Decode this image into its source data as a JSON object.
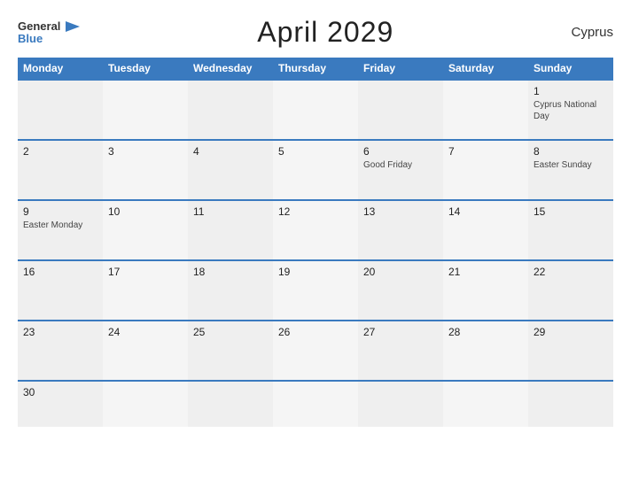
{
  "header": {
    "logo_general": "General",
    "logo_blue": "Blue",
    "title": "April 2029",
    "country": "Cyprus"
  },
  "columns": [
    "Monday",
    "Tuesday",
    "Wednesday",
    "Thursday",
    "Friday",
    "Saturday",
    "Sunday"
  ],
  "rows": [
    [
      {
        "day": "",
        "event": ""
      },
      {
        "day": "",
        "event": ""
      },
      {
        "day": "",
        "event": ""
      },
      {
        "day": "",
        "event": ""
      },
      {
        "day": "",
        "event": ""
      },
      {
        "day": "",
        "event": ""
      },
      {
        "day": "1",
        "event": "Cyprus National Day"
      }
    ],
    [
      {
        "day": "2",
        "event": ""
      },
      {
        "day": "3",
        "event": ""
      },
      {
        "day": "4",
        "event": ""
      },
      {
        "day": "5",
        "event": ""
      },
      {
        "day": "6",
        "event": "Good Friday"
      },
      {
        "day": "7",
        "event": ""
      },
      {
        "day": "8",
        "event": "Easter Sunday"
      }
    ],
    [
      {
        "day": "9",
        "event": "Easter Monday"
      },
      {
        "day": "10",
        "event": ""
      },
      {
        "day": "11",
        "event": ""
      },
      {
        "day": "12",
        "event": ""
      },
      {
        "day": "13",
        "event": ""
      },
      {
        "day": "14",
        "event": ""
      },
      {
        "day": "15",
        "event": ""
      }
    ],
    [
      {
        "day": "16",
        "event": ""
      },
      {
        "day": "17",
        "event": ""
      },
      {
        "day": "18",
        "event": ""
      },
      {
        "day": "19",
        "event": ""
      },
      {
        "day": "20",
        "event": ""
      },
      {
        "day": "21",
        "event": ""
      },
      {
        "day": "22",
        "event": ""
      }
    ],
    [
      {
        "day": "23",
        "event": ""
      },
      {
        "day": "24",
        "event": ""
      },
      {
        "day": "25",
        "event": ""
      },
      {
        "day": "26",
        "event": ""
      },
      {
        "day": "27",
        "event": ""
      },
      {
        "day": "28",
        "event": ""
      },
      {
        "day": "29",
        "event": ""
      }
    ],
    [
      {
        "day": "30",
        "event": ""
      },
      {
        "day": "",
        "event": ""
      },
      {
        "day": "",
        "event": ""
      },
      {
        "day": "",
        "event": ""
      },
      {
        "day": "",
        "event": ""
      },
      {
        "day": "",
        "event": ""
      },
      {
        "day": "",
        "event": ""
      }
    ]
  ]
}
